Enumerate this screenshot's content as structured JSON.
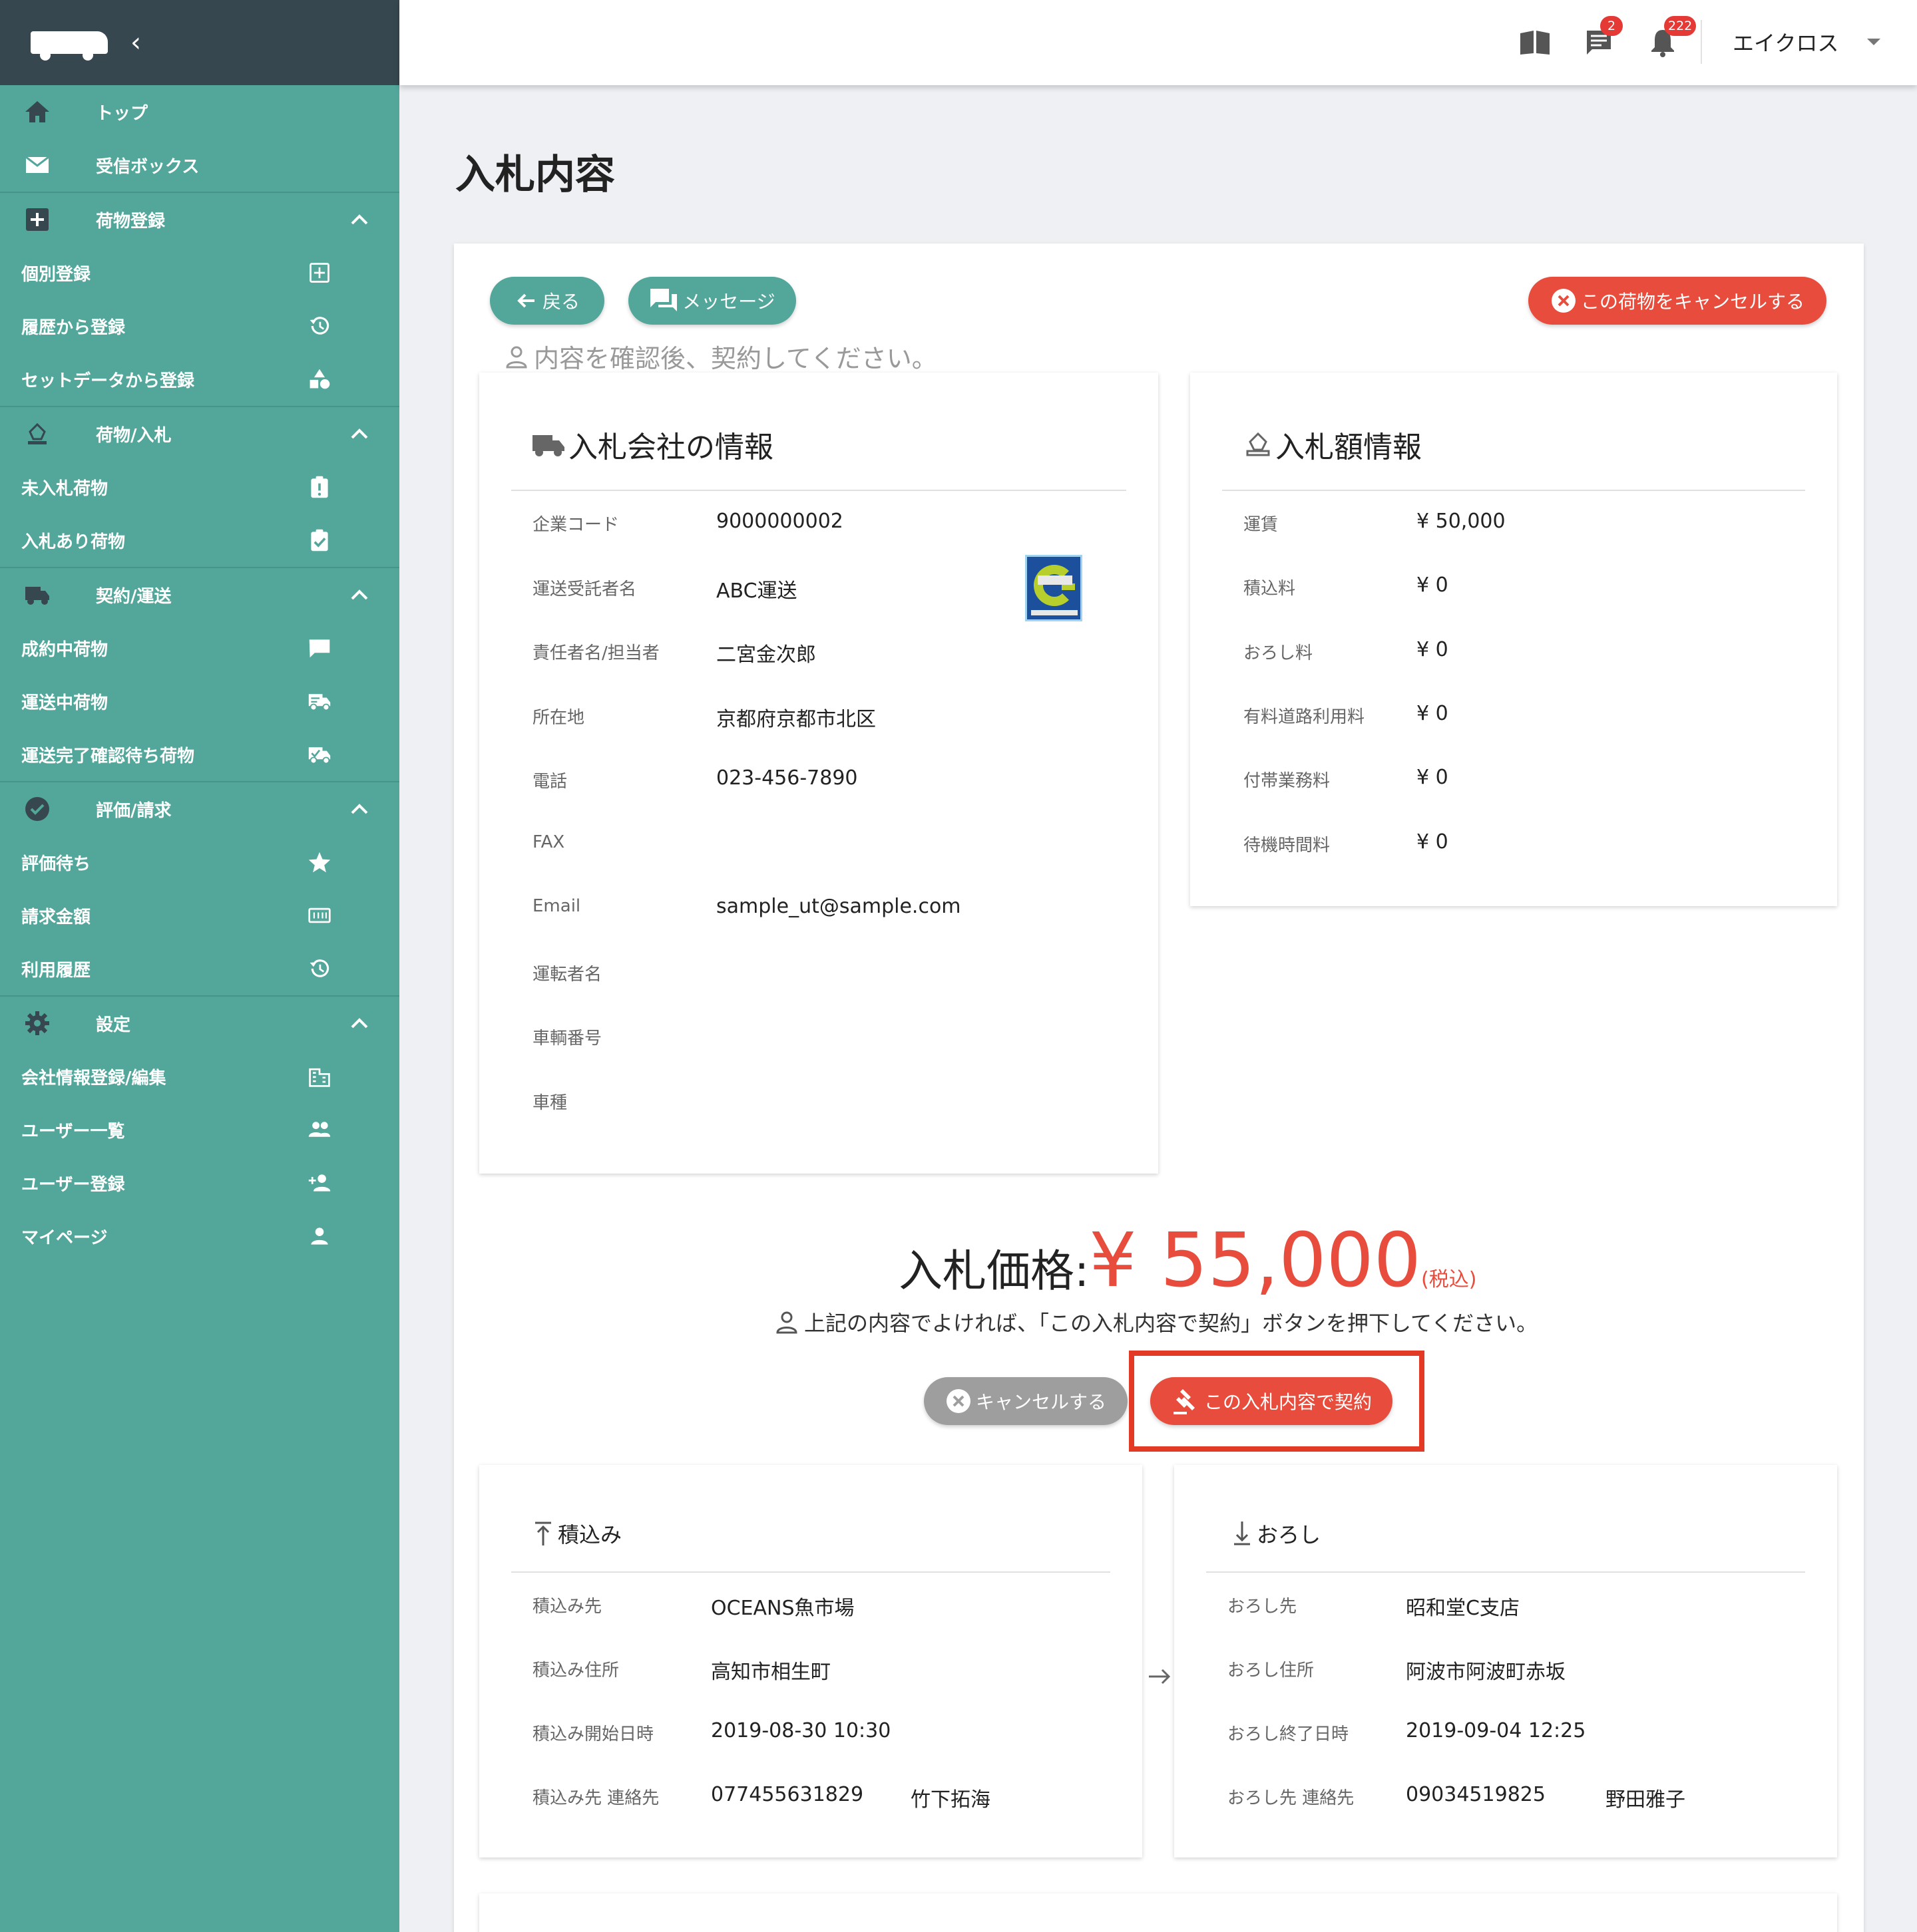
{
  "sidebar": {
    "items": [
      {
        "kind": "cat",
        "label": "トップ",
        "icon": "home-icon"
      },
      {
        "kind": "cat",
        "label": "受信ボックス",
        "icon": "mail-icon",
        "end_sec": true
      },
      {
        "kind": "cat",
        "label": "荷物登録",
        "icon": "plus-box-icon",
        "chevron": true
      },
      {
        "kind": "sub",
        "label": "個別登録",
        "icon": "plus-square-icon"
      },
      {
        "kind": "sub",
        "label": "履歴から登録",
        "icon": "history-icon"
      },
      {
        "kind": "sub",
        "label": "セットデータから登録",
        "icon": "shapes-icon",
        "end_sec": true
      },
      {
        "kind": "cat",
        "label": "荷物/入札",
        "icon": "gavel-stamp-icon",
        "chevron": true
      },
      {
        "kind": "sub",
        "label": "未入札荷物",
        "icon": "clipboard-alert-icon"
      },
      {
        "kind": "sub",
        "label": "入札あり荷物",
        "icon": "clipboard-check-icon",
        "end_sec": true
      },
      {
        "kind": "cat",
        "label": "契約/運送",
        "icon": "truck-icon",
        "chevron": true
      },
      {
        "kind": "sub",
        "label": "成約中荷物",
        "icon": "chat-truck-icon"
      },
      {
        "kind": "sub",
        "label": "運送中荷物",
        "icon": "truck-moving-icon"
      },
      {
        "kind": "sub",
        "label": "運送完了確認待ち荷物",
        "icon": "truck-check-icon",
        "end_sec": true
      },
      {
        "kind": "cat",
        "label": "評価/請求",
        "icon": "check-circle-icon",
        "chevron": true
      },
      {
        "kind": "sub",
        "label": "評価待ち",
        "icon": "star-icon"
      },
      {
        "kind": "sub",
        "label": "請求金額",
        "icon": "counter-icon"
      },
      {
        "kind": "sub",
        "label": "利用履歴",
        "icon": "history-icon",
        "end_sec": true
      },
      {
        "kind": "cat",
        "label": "設定",
        "icon": "gear-icon",
        "chevron": true
      },
      {
        "kind": "sub",
        "label": "会社情報登録/編集",
        "icon": "building-icon"
      },
      {
        "kind": "sub",
        "label": "ユーザー一覧",
        "icon": "users-icon"
      },
      {
        "kind": "sub",
        "label": "ユーザー登録",
        "icon": "user-add-icon"
      },
      {
        "kind": "sub",
        "label": "マイページ",
        "icon": "user-icon"
      }
    ]
  },
  "header": {
    "message_badge": "2",
    "notification_badge": "222",
    "user_name": "エイクロス"
  },
  "page": {
    "title": "入札内容",
    "back_label": "戻る",
    "message_label": "メッセージ",
    "cancel_cargo_label": "この荷物をキャンセルする",
    "hint_top": "内容を確認後、契約してください。"
  },
  "company": {
    "title": "入札会社の情報",
    "rows": [
      {
        "k": "企業コード",
        "v": "9000000002"
      },
      {
        "k": "運送受託者名",
        "v": "ABC運送"
      },
      {
        "k": "責任者名/担当者",
        "v": "二宮金次郎"
      },
      {
        "k": "所在地",
        "v": "京都府京都市北区"
      },
      {
        "k": "電話",
        "v": "023-456-7890"
      },
      {
        "k": "FAX",
        "v": ""
      },
      {
        "k": "Email",
        "v": "sample_ut@sample.com"
      },
      {
        "k": "運転者名",
        "v": ""
      },
      {
        "k": "車輌番号",
        "v": ""
      },
      {
        "k": "車種",
        "v": ""
      }
    ]
  },
  "bid_amount": {
    "title": "入札額情報",
    "rows": [
      {
        "k": "運賃",
        "v": "¥ 50,000"
      },
      {
        "k": "積込料",
        "v": "¥ 0"
      },
      {
        "k": "おろし料",
        "v": "¥ 0"
      },
      {
        "k": "有料道路利用料",
        "v": "¥ 0"
      },
      {
        "k": "付帯業務料",
        "v": "¥ 0"
      },
      {
        "k": "待機時間料",
        "v": "¥ 0"
      }
    ]
  },
  "price": {
    "label": "入札価格:",
    "value": "¥ 55,000",
    "tax": "(税込)",
    "hint": "上記の内容でよければ、「この入札内容で契約」ボタンを押下してください。",
    "cancel_label": "キャンセルする",
    "contract_label": "この入札内容で契約"
  },
  "loading": {
    "title": "積込み",
    "rows": [
      {
        "k": "積込み先",
        "v": "OCEANS魚市場"
      },
      {
        "k": "積込み住所",
        "v": "高知市相生町"
      },
      {
        "k": "積込み開始日時",
        "v": "2019-08-30 10:30"
      },
      {
        "k": "積込み先 連絡先",
        "v": "077455631829",
        "v2": "竹下拓海"
      }
    ]
  },
  "unloading": {
    "title": "おろし",
    "rows": [
      {
        "k": "おろし先",
        "v": "昭和堂C支店"
      },
      {
        "k": "おろし住所",
        "v": "阿波市阿波町赤坂"
      },
      {
        "k": "おろし終了日時",
        "v": "2019-09-04 12:25"
      },
      {
        "k": "おろし先 連絡先",
        "v": "09034519825",
        "v2": "野田雅子"
      }
    ]
  },
  "colors": {
    "sidebar": "#52a69a",
    "sidebar_header": "#37474f",
    "accent_red": "#e74c3c",
    "highlight": "#e23a24"
  }
}
